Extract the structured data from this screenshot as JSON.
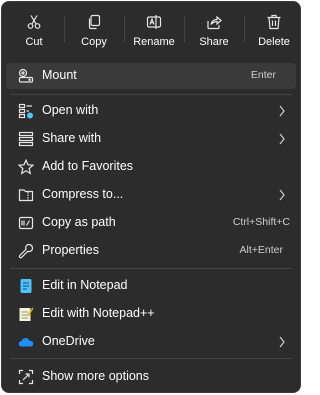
{
  "toolbar": {
    "buttons": [
      {
        "label": "Cut",
        "icon": "scissors-icon"
      },
      {
        "label": "Copy",
        "icon": "copy-icon"
      },
      {
        "label": "Rename",
        "icon": "rename-icon"
      },
      {
        "label": "Share",
        "icon": "share-icon"
      },
      {
        "label": "Delete",
        "icon": "trash-icon"
      }
    ]
  },
  "menu": {
    "mount": {
      "label": "Mount",
      "shortcut": "Enter",
      "icon": "disc-drive-icon"
    },
    "open_with": {
      "label": "Open with",
      "icon": "open-with-icon"
    },
    "share_with": {
      "label": "Share with",
      "icon": "share-with-icon"
    },
    "add_favorites": {
      "label": "Add to Favorites",
      "icon": "star-icon"
    },
    "compress": {
      "label": "Compress to...",
      "icon": "folder-zip-icon"
    },
    "copy_path": {
      "label": "Copy as path",
      "shortcut": "Ctrl+Shift+C",
      "icon": "copy-path-icon"
    },
    "properties": {
      "label": "Properties",
      "shortcut": "Alt+Enter",
      "icon": "wrench-icon"
    },
    "notepad": {
      "label": "Edit in Notepad",
      "icon": "notepad-icon"
    },
    "notepadpp": {
      "label": "Edit with Notepad++",
      "icon": "notepadpp-icon"
    },
    "onedrive": {
      "label": "OneDrive",
      "icon": "cloud-icon"
    },
    "more_options": {
      "label": "Show more options",
      "icon": "expand-icon"
    }
  },
  "colors": {
    "background": "#2c2c2c",
    "highlight": "#3a3a3a",
    "accent": "#4cc2ff",
    "onedrive": "#1e90ff"
  }
}
